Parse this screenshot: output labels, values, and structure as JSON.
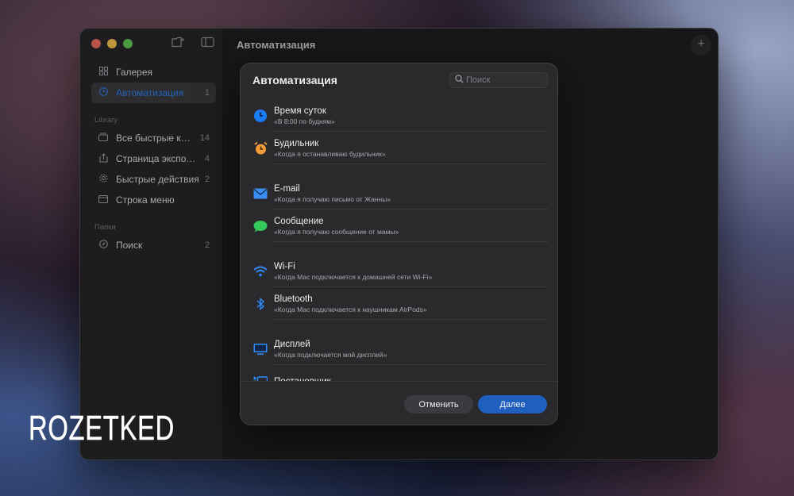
{
  "window": {
    "main_title": "Автоматизация"
  },
  "sidebar": {
    "items_top": [
      {
        "label": "Галерея",
        "icon": "grid-icon",
        "count": ""
      },
      {
        "label": "Автоматизация",
        "icon": "clock-icon",
        "count": "1",
        "active": true
      }
    ],
    "section_library": "Library",
    "items_library": [
      {
        "label": "Все быстрые команды",
        "count": "14",
        "icon": "stack-icon"
      },
      {
        "label": "Страница экспорта",
        "count": "4",
        "icon": "share-icon"
      },
      {
        "label": "Быстрые действия",
        "count": "2",
        "icon": "gear-icon"
      },
      {
        "label": "Строка меню",
        "count": "",
        "icon": "menubar-icon"
      }
    ],
    "section_folders": "Папки",
    "items_folders": [
      {
        "label": "Поиск",
        "count": "2",
        "icon": "compass-icon"
      }
    ]
  },
  "sheet": {
    "title": "Автоматизация",
    "search_placeholder": "Поиск",
    "triggers": [
      {
        "name": "Время суток",
        "desc": "«В 8:00 по будням»",
        "icon": "clock-icon",
        "color": "#1a7cf2"
      },
      {
        "name": "Будильник",
        "desc": "«Когда я останавливаю будильник»",
        "icon": "alarm-icon",
        "color": "#f29b38"
      },
      {
        "name": "E-mail",
        "desc": "«Когда я получаю письмо от Жанны»",
        "icon": "mail-icon",
        "color": "#3a8ef6"
      },
      {
        "name": "Сообщение",
        "desc": "«Когда я получаю сообщение от мамы»",
        "icon": "message-icon",
        "color": "#34c759"
      },
      {
        "name": "Wi-Fi",
        "desc": "«Когда Mac подключается к домашней сети Wi-Fi»",
        "icon": "wifi-icon",
        "color": "#2f8cff"
      },
      {
        "name": "Bluetooth",
        "desc": "«Когда Mac подключается к наушникам AirPods»",
        "icon": "bluetooth-icon",
        "color": "#2f8cff"
      },
      {
        "name": "Дисплей",
        "desc": "«Когда подключается мой дисплей»",
        "icon": "display-icon",
        "color": "#2f8cff"
      },
      {
        "name": "Постановщик",
        "desc": "",
        "icon": "stage-manager-icon",
        "color": "#2f8cff"
      }
    ],
    "cancel_label": "Отменить",
    "next_label": "Далее"
  },
  "watermark": {
    "text": "ROZETKED"
  }
}
